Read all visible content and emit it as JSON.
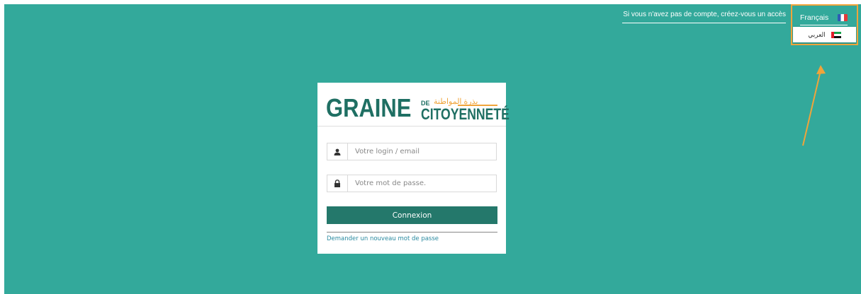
{
  "header": {
    "signup_link": "Si vous n'avez pas de compte, créez-vous un accès"
  },
  "language": {
    "current": "Français",
    "current_flag": "france-flag-icon",
    "options": [
      {
        "label": "العربي",
        "flag": "uae-flag-icon"
      }
    ],
    "highlight_color": "#f0a43a"
  },
  "login": {
    "logo": {
      "main": "GRAINE",
      "de": "DE",
      "arabic": "بذرة المواطنة",
      "sub": "CITOYENNETÉ"
    },
    "login_placeholder": "Votre login / email",
    "password_placeholder": "Votre mot de passe.",
    "submit_label": "Connexion",
    "forgot_link": "Demander un nouveau mot de passe"
  },
  "colors": {
    "background": "#33a99b",
    "brand": "#1f6f63",
    "button": "#24786b",
    "accent": "#f0a43a",
    "link": "#2a8aa0"
  },
  "icons": {
    "user": "user-icon",
    "lock": "lock-icon",
    "arrow": "annotation-arrow"
  }
}
